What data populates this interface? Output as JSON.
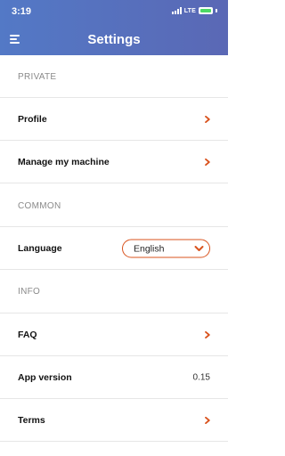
{
  "status_bar": {
    "time": "3:19",
    "network": "LTE"
  },
  "header": {
    "title": "Settings",
    "menu_icon": "menu-icon"
  },
  "sections": {
    "private": {
      "label": "PRIVATE",
      "items": [
        {
          "label": "Profile",
          "icon": "chevron-right-icon"
        },
        {
          "label": "Manage my machine",
          "icon": "chevron-right-icon"
        }
      ]
    },
    "common": {
      "label": "COMMON",
      "language": {
        "label": "Language",
        "value": "English",
        "icon": "chevron-down-icon"
      }
    },
    "info": {
      "label": "INFO",
      "faq": {
        "label": "FAQ",
        "icon": "chevron-right-icon"
      },
      "app_version": {
        "label": "App version",
        "value": "0.15"
      },
      "terms": {
        "label": "Terms",
        "icon": "chevron-right-icon"
      }
    }
  },
  "colors": {
    "header_start": "#5379c6",
    "header_end": "#5a68b5",
    "accent": "#d9531e"
  }
}
